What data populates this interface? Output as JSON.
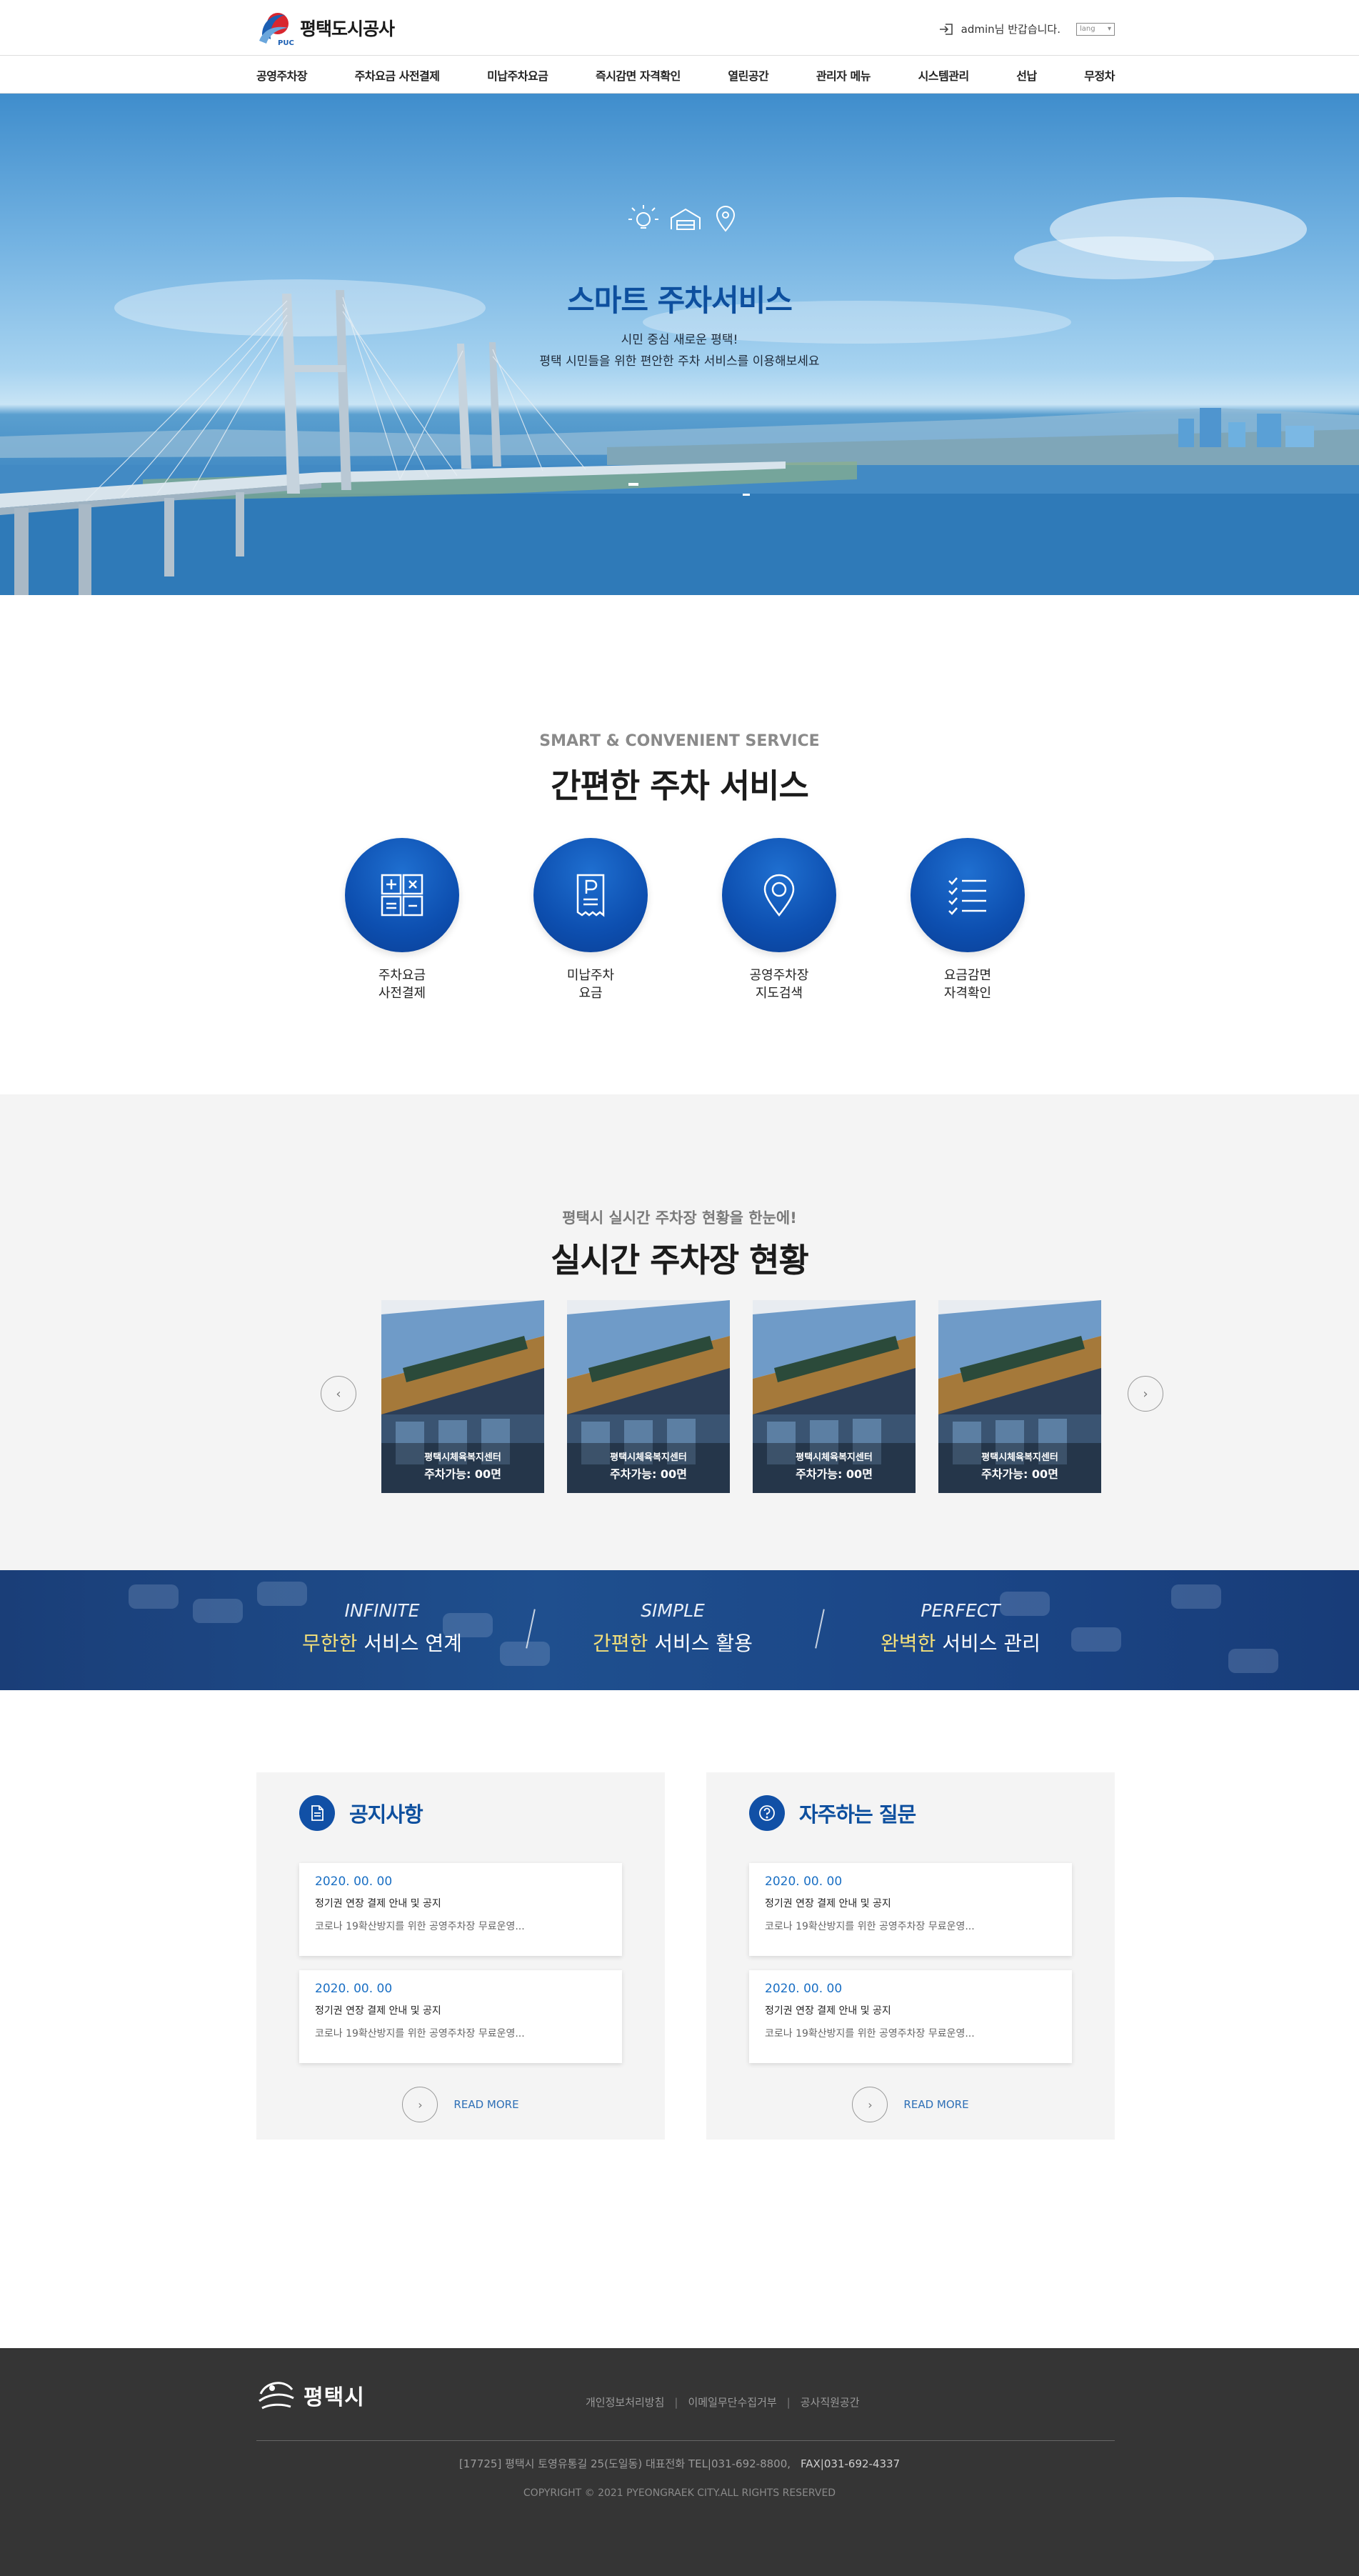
{
  "header": {
    "logo_text": "평택도시공사",
    "logo_mark_text": "PUC",
    "user_greeting": "admin님 반갑습니다.",
    "lang_select": "lang"
  },
  "nav": {
    "items": [
      {
        "label": "공영주차장"
      },
      {
        "label": "주차요금 사전결제"
      },
      {
        "label": "미납주차요금"
      },
      {
        "label": "즉시감면 자격확인"
      },
      {
        "label": "열린공간"
      },
      {
        "label": "관리자 메뉴"
      },
      {
        "label": "시스템관리"
      },
      {
        "label": "선납"
      },
      {
        "label": "무정차"
      }
    ]
  },
  "hero": {
    "title": "스마트 주차서비스",
    "sub1": "시민 중심 새로운 평택!",
    "sub2": "평택 시민들을 위한 편안한 주차 서비스를 이용해보세요",
    "icons": [
      "lightbulb-icon",
      "garage-icon",
      "location-pin-icon"
    ]
  },
  "services": {
    "eyebrow": "SMART & CONVENIENT SERVICE",
    "title": "간편한 주차 서비스",
    "items": [
      {
        "label": "주차요금\n사전결제",
        "icon": "calculator-icon"
      },
      {
        "label": "미납주차\n요금",
        "icon": "parking-receipt-icon"
      },
      {
        "label": "공영주차장\n지도검색",
        "icon": "map-pin-icon"
      },
      {
        "label": "요금감면\n자격확인",
        "icon": "checklist-icon"
      }
    ]
  },
  "realtime": {
    "eyebrow": "평택시 실시간 주차장 현황을 한눈에!",
    "title": "실시간 주차장 현황",
    "lots": [
      {
        "name": "평택시체육복지센터",
        "avail": "주차가능: 00면"
      },
      {
        "name": "평택시체육복지센터",
        "avail": "주차가능: 00면"
      },
      {
        "name": "평택시체육복지센터",
        "avail": "주차가능: 00면"
      },
      {
        "name": "평택시체육복지센터",
        "avail": "주차가능: 00면"
      }
    ],
    "prev": "‹",
    "next": "›"
  },
  "banner": {
    "items": [
      {
        "en": "INFINITE",
        "hl": "무한한",
        "rest": " 서비스 연계"
      },
      {
        "en": "SIMPLE",
        "hl": "간편한",
        "rest": " 서비스 활용"
      },
      {
        "en": "PERFECT",
        "hl": "완벽한",
        "rest": " 서비스 관리"
      }
    ]
  },
  "boards": [
    {
      "title": "공지사항",
      "icon": "document-icon",
      "posts": [
        {
          "date": "2020. 00. 00",
          "subject": "정기권 연장 결제 안내 및 공지",
          "summary": "코로나 19확산방지를 위한 공영주차장 무료운영..."
        },
        {
          "date": "2020. 00. 00",
          "subject": "정기권 연장 결제 안내 및 공지",
          "summary": "코로나 19확산방지를 위한 공영주차장 무료운영..."
        }
      ],
      "readmore": "READ MORE"
    },
    {
      "title": "자주하는 질문",
      "icon": "question-icon",
      "posts": [
        {
          "date": "2020. 00. 00",
          "subject": "정기권 연장 결제 안내 및 공지",
          "summary": "코로나 19확산방지를 위한 공영주차장 무료운영..."
        },
        {
          "date": "2020. 00. 00",
          "subject": "정기권 연장 결제 안내 및 공지",
          "summary": "코로나 19확산방지를 위한 공영주차장 무료운영..."
        }
      ],
      "readmore": "READ MORE"
    }
  ],
  "footer": {
    "logo_text": "평택시",
    "links": [
      "개인정보처리방침",
      "이메일무단수집거부",
      "공사직원공간"
    ],
    "address": "[17725] 평택시 토영유통길 25(도일동)     대표전화 TEL|031-692-8800,",
    "fax": "FAX|031-692-4337",
    "copyright": "COPYRIGHT © 2021 PYEONGRAEK CITY.ALL RIGHTS RESERVED"
  },
  "colors": {
    "primary": "#0d4f9e",
    "accent_blue": "#1150a6",
    "highlight_yellow": "#f3e07a",
    "footer_bg": "#353535",
    "section_gray": "#f4f4f4"
  }
}
